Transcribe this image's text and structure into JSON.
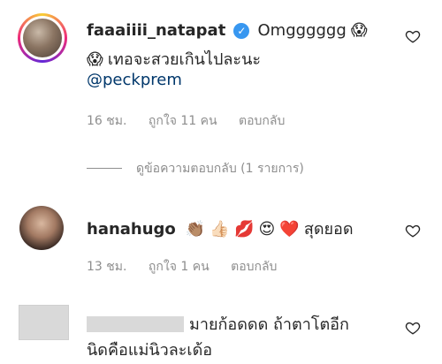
{
  "comments": [
    {
      "username": "faaaiiii_natapat",
      "verified": true,
      "text_line1": "Omgggggg",
      "text_line2": "เทอจะสวยเกินไปละนะ",
      "mention": "@peckprem",
      "time": "16 ชม.",
      "likes": "ถูกใจ 11 คน",
      "reply": "ตอบกลับ",
      "view_replies": "ดูข้อความตอบกลับ (1 รายการ)"
    },
    {
      "username": "hanahugo",
      "text": "สุดยอด",
      "time": "13 ชม.",
      "likes": "ถูกใจ 1 คน",
      "reply": "ตอบกลับ"
    },
    {
      "text_line1": "มายก้อดดด ถ้าตาโตอีก",
      "text_line2": "นิดคือแม่นิวละเด้อ"
    }
  ],
  "icons": {
    "like": "heart-outline-icon",
    "verified": "verified-badge-icon",
    "scream": "face-screaming-emoji",
    "clap": "clapping-hands-emoji",
    "thumbs": "thumbs-up-emoji",
    "lips": "kiss-mark-emoji",
    "heart_eyes": "heart-eyes-emoji",
    "red_heart": "red-heart-emoji"
  },
  "colors": {
    "text": "#262626",
    "meta": "#8e8e8e",
    "mention": "#00376b",
    "verified": "#3897f0"
  }
}
